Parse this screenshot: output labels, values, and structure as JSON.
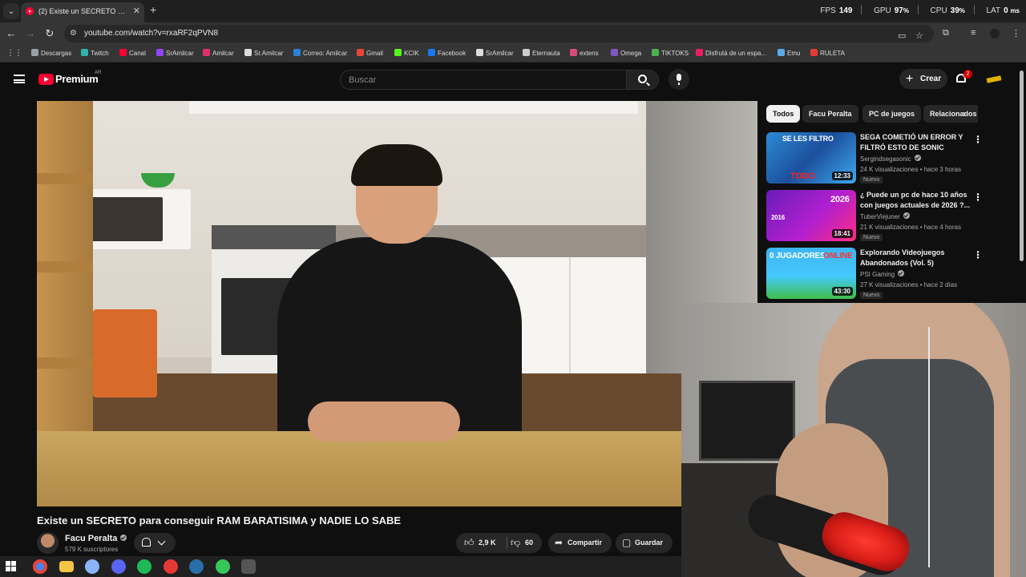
{
  "browser": {
    "tab_title": "(2) Existe un SECRETO para con",
    "url": "youtube.com/watch?v=rxaRF2qPVN8",
    "bookmarks": [
      {
        "label": "Descargas",
        "color": "#9aa0a6"
      },
      {
        "label": "Twitch",
        "color": "#2fb5a5"
      },
      {
        "label": "Canal",
        "color": "#ff0033"
      },
      {
        "label": "SrAmilcar",
        "color": "#9146ff"
      },
      {
        "label": "Amilcar",
        "color": "#e1306c"
      },
      {
        "label": "Sr.Amilcar",
        "color": "#dddddd"
      },
      {
        "label": "Correo: Amilcar",
        "color": "#2d7fd8"
      },
      {
        "label": "Gmail",
        "color": "#ea4335"
      },
      {
        "label": "KCIK",
        "color": "#53fc18"
      },
      {
        "label": "Facebook",
        "color": "#1877f2"
      },
      {
        "label": "SrAmilcar",
        "color": "#dddddd"
      },
      {
        "label": "Eternauta",
        "color": "#cccccc"
      },
      {
        "label": "extens",
        "color": "#d94c7a"
      },
      {
        "label": "Omega",
        "color": "#7e57c2"
      },
      {
        "label": "TIKTOKS",
        "color": "#4caf50"
      },
      {
        "label": "Disfrutá de un espa...",
        "color": "#e91e63"
      },
      {
        "label": "Emu",
        "color": "#5aa9e6"
      },
      {
        "label": "RULETA",
        "color": "#e53935"
      }
    ]
  },
  "overlay": {
    "fps_label": "FPS",
    "fps_value": "149",
    "gpu_label": "GPU",
    "gpu_value": "97",
    "gpu_unit": "%",
    "cpu_label": "CPU",
    "cpu_value": "39",
    "cpu_unit": "%",
    "lat_label": "LAT",
    "lat_value": "0",
    "lat_unit": "ms"
  },
  "youtube": {
    "logo_text": "Premium",
    "country": "AR",
    "search_placeholder": "Buscar",
    "create_label": "Crear",
    "notifications_count": "2"
  },
  "video": {
    "title": "Existe un SECRETO para conseguir RAM BARATISIMA y NADIE LO SABE",
    "channel": "Facu Peralta",
    "subscribers": "579 K suscriptores",
    "likes": "2,9 K",
    "dislikes": "60",
    "share_label": "Compartir",
    "save_label": "Guardar"
  },
  "chips": [
    "Todos",
    "Facu Peralta",
    "PC de juegos",
    "Relacionados"
  ],
  "recommendations": [
    {
      "title": "SEGA COMETIÓ UN ERROR Y FILTRÓ ESTO DE SONIC",
      "channel": "Sergindsegasonic",
      "meta": "24 K visualizaciones • hace 3 horas",
      "badge": "Nuevo",
      "duration": "12:33",
      "thumb_text": "SE LES FILTRO",
      "thumb_text2": "TODO"
    },
    {
      "title": "¿ Puede un pc de hace 10 años con juegos actuales de 2026 ?...",
      "channel": "TuberViejuner",
      "meta": "21 K visualizaciones • hace 4 horas",
      "badge": "Nuevo",
      "duration": "18:41",
      "thumb_text": "2026",
      "thumb_text2": "2016"
    },
    {
      "title": "Explorando Videojuegos Abandonados (Vol. 5)",
      "channel": "PSI Gaming",
      "meta": "27 K visualizaciones • hace 2 días",
      "badge": "Nuevo",
      "duration": "43:30",
      "thumb_text": "0 JUGADORES",
      "thumb_text2": "ONLINE"
    }
  ],
  "taskbar": {
    "apps": [
      {
        "name": "chrome",
        "color": "#4285f4"
      },
      {
        "name": "file-explorer",
        "color": "#f4c542"
      },
      {
        "name": "app-3",
        "color": "#8ab4f8"
      },
      {
        "name": "discord",
        "color": "#5865f2"
      },
      {
        "name": "spotify",
        "color": "#1db954"
      },
      {
        "name": "app-6",
        "color": "#e53935"
      },
      {
        "name": "steam",
        "color": "#2a6ea8"
      },
      {
        "name": "app-8",
        "color": "#35c759"
      },
      {
        "name": "app-9",
        "color": "#555555"
      }
    ]
  }
}
